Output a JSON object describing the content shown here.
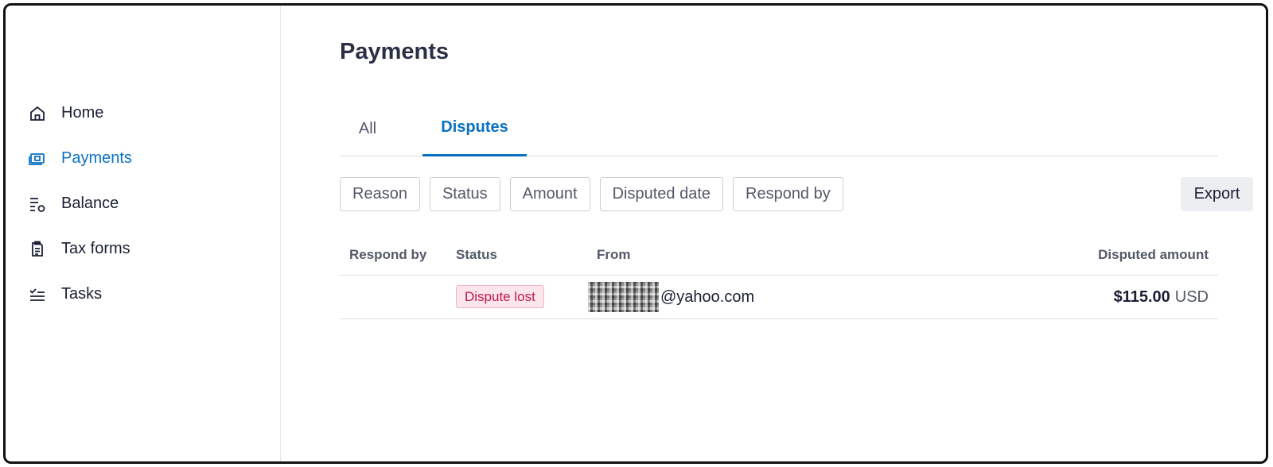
{
  "sidebar": {
    "items": [
      {
        "label": "Home",
        "icon": "home-icon"
      },
      {
        "label": "Payments",
        "icon": "payments-icon",
        "active": true
      },
      {
        "label": "Balance",
        "icon": "balance-icon"
      },
      {
        "label": "Tax forms",
        "icon": "tax-forms-icon"
      },
      {
        "label": "Tasks",
        "icon": "tasks-icon"
      }
    ]
  },
  "main": {
    "title": "Payments",
    "tabs": [
      {
        "label": "All"
      },
      {
        "label": "Disputes",
        "active": true
      }
    ],
    "filters": [
      "Reason",
      "Status",
      "Amount",
      "Disputed date",
      "Respond by"
    ],
    "export_label": "Export",
    "table": {
      "headers": {
        "respond_by": "Respond by",
        "status": "Status",
        "from": "From",
        "disputed_amount": "Disputed amount"
      },
      "rows": [
        {
          "respond_by": "",
          "status": "Dispute lost",
          "from": "@yahoo.com",
          "amount": "$115.00",
          "currency": "USD"
        }
      ]
    }
  },
  "colors": {
    "accent": "#0a72c4",
    "badge_text": "#c3174d",
    "badge_bg": "#fce6ec"
  }
}
